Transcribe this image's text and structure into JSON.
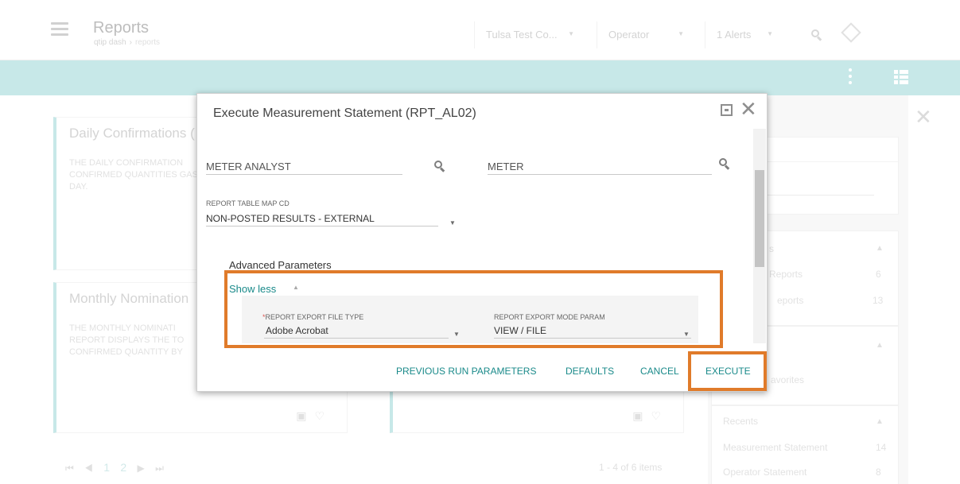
{
  "header": {
    "title": "Reports",
    "breadcrumb": [
      "qtip dash",
      "reports"
    ],
    "company": "Tulsa Test Co...",
    "role": "Operator",
    "alerts": "1 Alerts"
  },
  "cards": [
    {
      "title": "Daily Confirmations (",
      "desc": "THE DAILY CONFIRMATION CONFIRMED QUANTITIES GAS DAY."
    },
    {
      "title": "Monthly Nomination",
      "desc": "THE MONTHLY NOMINATI REPORT DISPLAYS THE TO CONFIRMED QUANTITY BY"
    }
  ],
  "pager": {
    "pages": [
      "1",
      "2"
    ],
    "items": "1 - 4 of 6 items"
  },
  "side_panel": {
    "rows": [
      {
        "label": "s",
        "num": ""
      },
      {
        "label": "Reports",
        "num": "6"
      },
      {
        "label": "eports",
        "num": "13"
      },
      {
        "label": "avorites",
        "num": ""
      },
      {
        "label": "Recents",
        "num": ""
      },
      {
        "label": "Measurement Statement",
        "num": "14"
      },
      {
        "label": "Operator Statement",
        "num": "8"
      }
    ]
  },
  "dialog": {
    "title": "Execute Measurement Statement (RPT_AL02)",
    "meter_analyst_placeholder": "METER ANALYST",
    "meter_placeholder": "METER",
    "report_table_map_label": "REPORT TABLE MAP CD",
    "report_table_map_value": "NON-POSTED RESULTS - EXTERNAL",
    "advanced_title": "Advanced Parameters",
    "show_less": "Show less",
    "export_file_type_label": "REPORT EXPORT FILE TYPE",
    "export_file_type_value": "Adobe Acrobat",
    "export_mode_label": "REPORT EXPORT MODE PARAM",
    "export_mode_value": "VIEW / FILE",
    "buttons": {
      "previous_run": "PREVIOUS RUN PARAMETERS",
      "defaults": "DEFAULTS",
      "cancel": "CANCEL",
      "execute": "EXECUTE"
    }
  },
  "colors": {
    "teal_bar": "#a9dcdc",
    "accent_text": "#1a8a8a",
    "highlight": "#e07b2a",
    "required": "#d9534f"
  },
  "icons": [
    "menu-icon",
    "search-icon",
    "compass-icon",
    "kebab-icon",
    "grid-view-icon",
    "close-icon",
    "maximize-icon",
    "folder-icon",
    "heart-icon",
    "caret-down-icon",
    "chevron-up-icon"
  ]
}
